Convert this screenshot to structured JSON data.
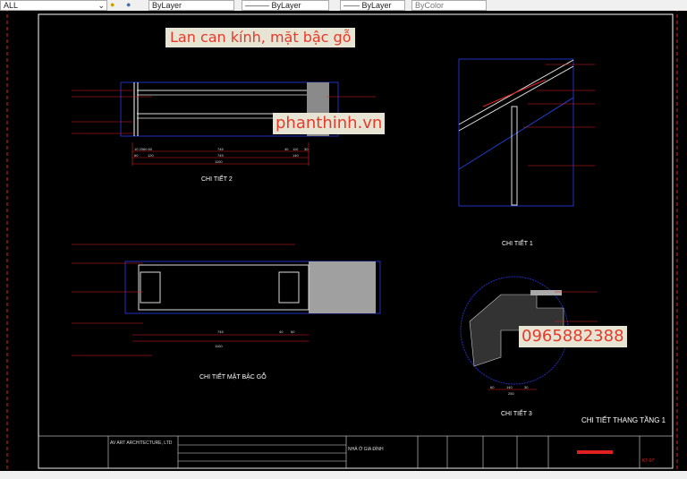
{
  "toolbar": {
    "layer_filter": "ALL",
    "color": "ByLayer",
    "linetype": "ByLayer",
    "lineweight": "ByLayer",
    "plotstyle": "ByColor"
  },
  "overlays": {
    "title": "Lan can kính, mặt bậc gỗ",
    "website": "phanthinh.vn",
    "phone": "0965882388"
  },
  "drawing": {
    "detail2": {
      "title": "CHI TIẾT 2",
      "dims_top": [
        "10",
        "20",
        "60",
        "60",
        "745",
        "40",
        "110",
        "30"
      ],
      "dims_mid": [
        "60",
        "120",
        "745",
        "140"
      ],
      "total": "1100"
    },
    "detail1": {
      "title": "CHI TIẾT 1"
    },
    "detail_tread": {
      "title": "CHI TIẾT MẶT BẬC GỖ",
      "dims": [
        "745",
        "40",
        "60"
      ],
      "total": "1100"
    },
    "detail3": {
      "title": "CHI TIẾT 3",
      "dims": [
        "60",
        "140",
        "30"
      ],
      "total": "250"
    },
    "sheet_title": "CHI TIẾT THANG TẦNG 1"
  },
  "title_block": {
    "company": "AV ART ARCHITECTURE, LTD",
    "project": "NHÀ Ở GIA ĐÌNH",
    "drawing_no": "KT-07"
  },
  "colors": {
    "dimension": "#e02020",
    "frame": "#ffffff",
    "viewport": "#2030c0",
    "banner_text": "#e53b2a"
  }
}
